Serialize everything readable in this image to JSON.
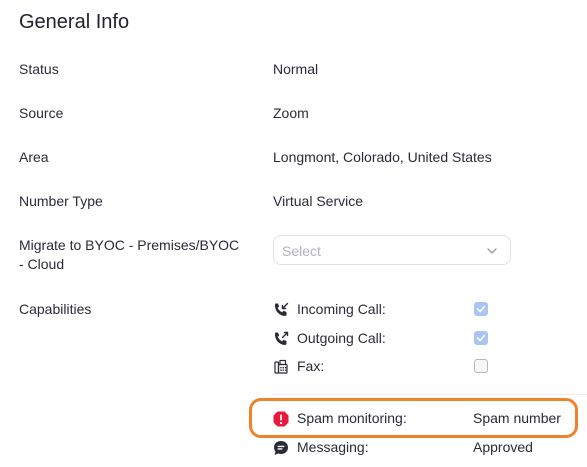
{
  "section": {
    "title": "General Info"
  },
  "fields": {
    "status": {
      "label": "Status",
      "value": "Normal"
    },
    "source": {
      "label": "Source",
      "value": "Zoom"
    },
    "area": {
      "label": "Area",
      "value": "Longmont, Colorado, United States"
    },
    "number_type": {
      "label": "Number Type",
      "value": "Virtual Service"
    },
    "migrate": {
      "label_line1": "Migrate to BYOC - Premises/BYOC",
      "label_line2": "- Cloud",
      "placeholder": "Select"
    },
    "capabilities": {
      "label": "Capabilities",
      "items": [
        {
          "label": "Incoming Call:",
          "icon": "incoming-call-icon",
          "checked": true
        },
        {
          "label": "Outgoing Call:",
          "icon": "outgoing-call-icon",
          "checked": true
        },
        {
          "label": "Fax:",
          "icon": "fax-icon",
          "checked": false
        }
      ],
      "spam": {
        "label": "Spam monitoring:",
        "value": "Spam number",
        "icon": "alert-octagon-icon",
        "icon_color": "#e8193c"
      },
      "messaging": {
        "label": "Messaging:",
        "value": "Approved",
        "icon": "message-icon"
      }
    }
  },
  "colors": {
    "highlight": "#f0832a",
    "checkbox_checked": "#a9c6f3"
  }
}
